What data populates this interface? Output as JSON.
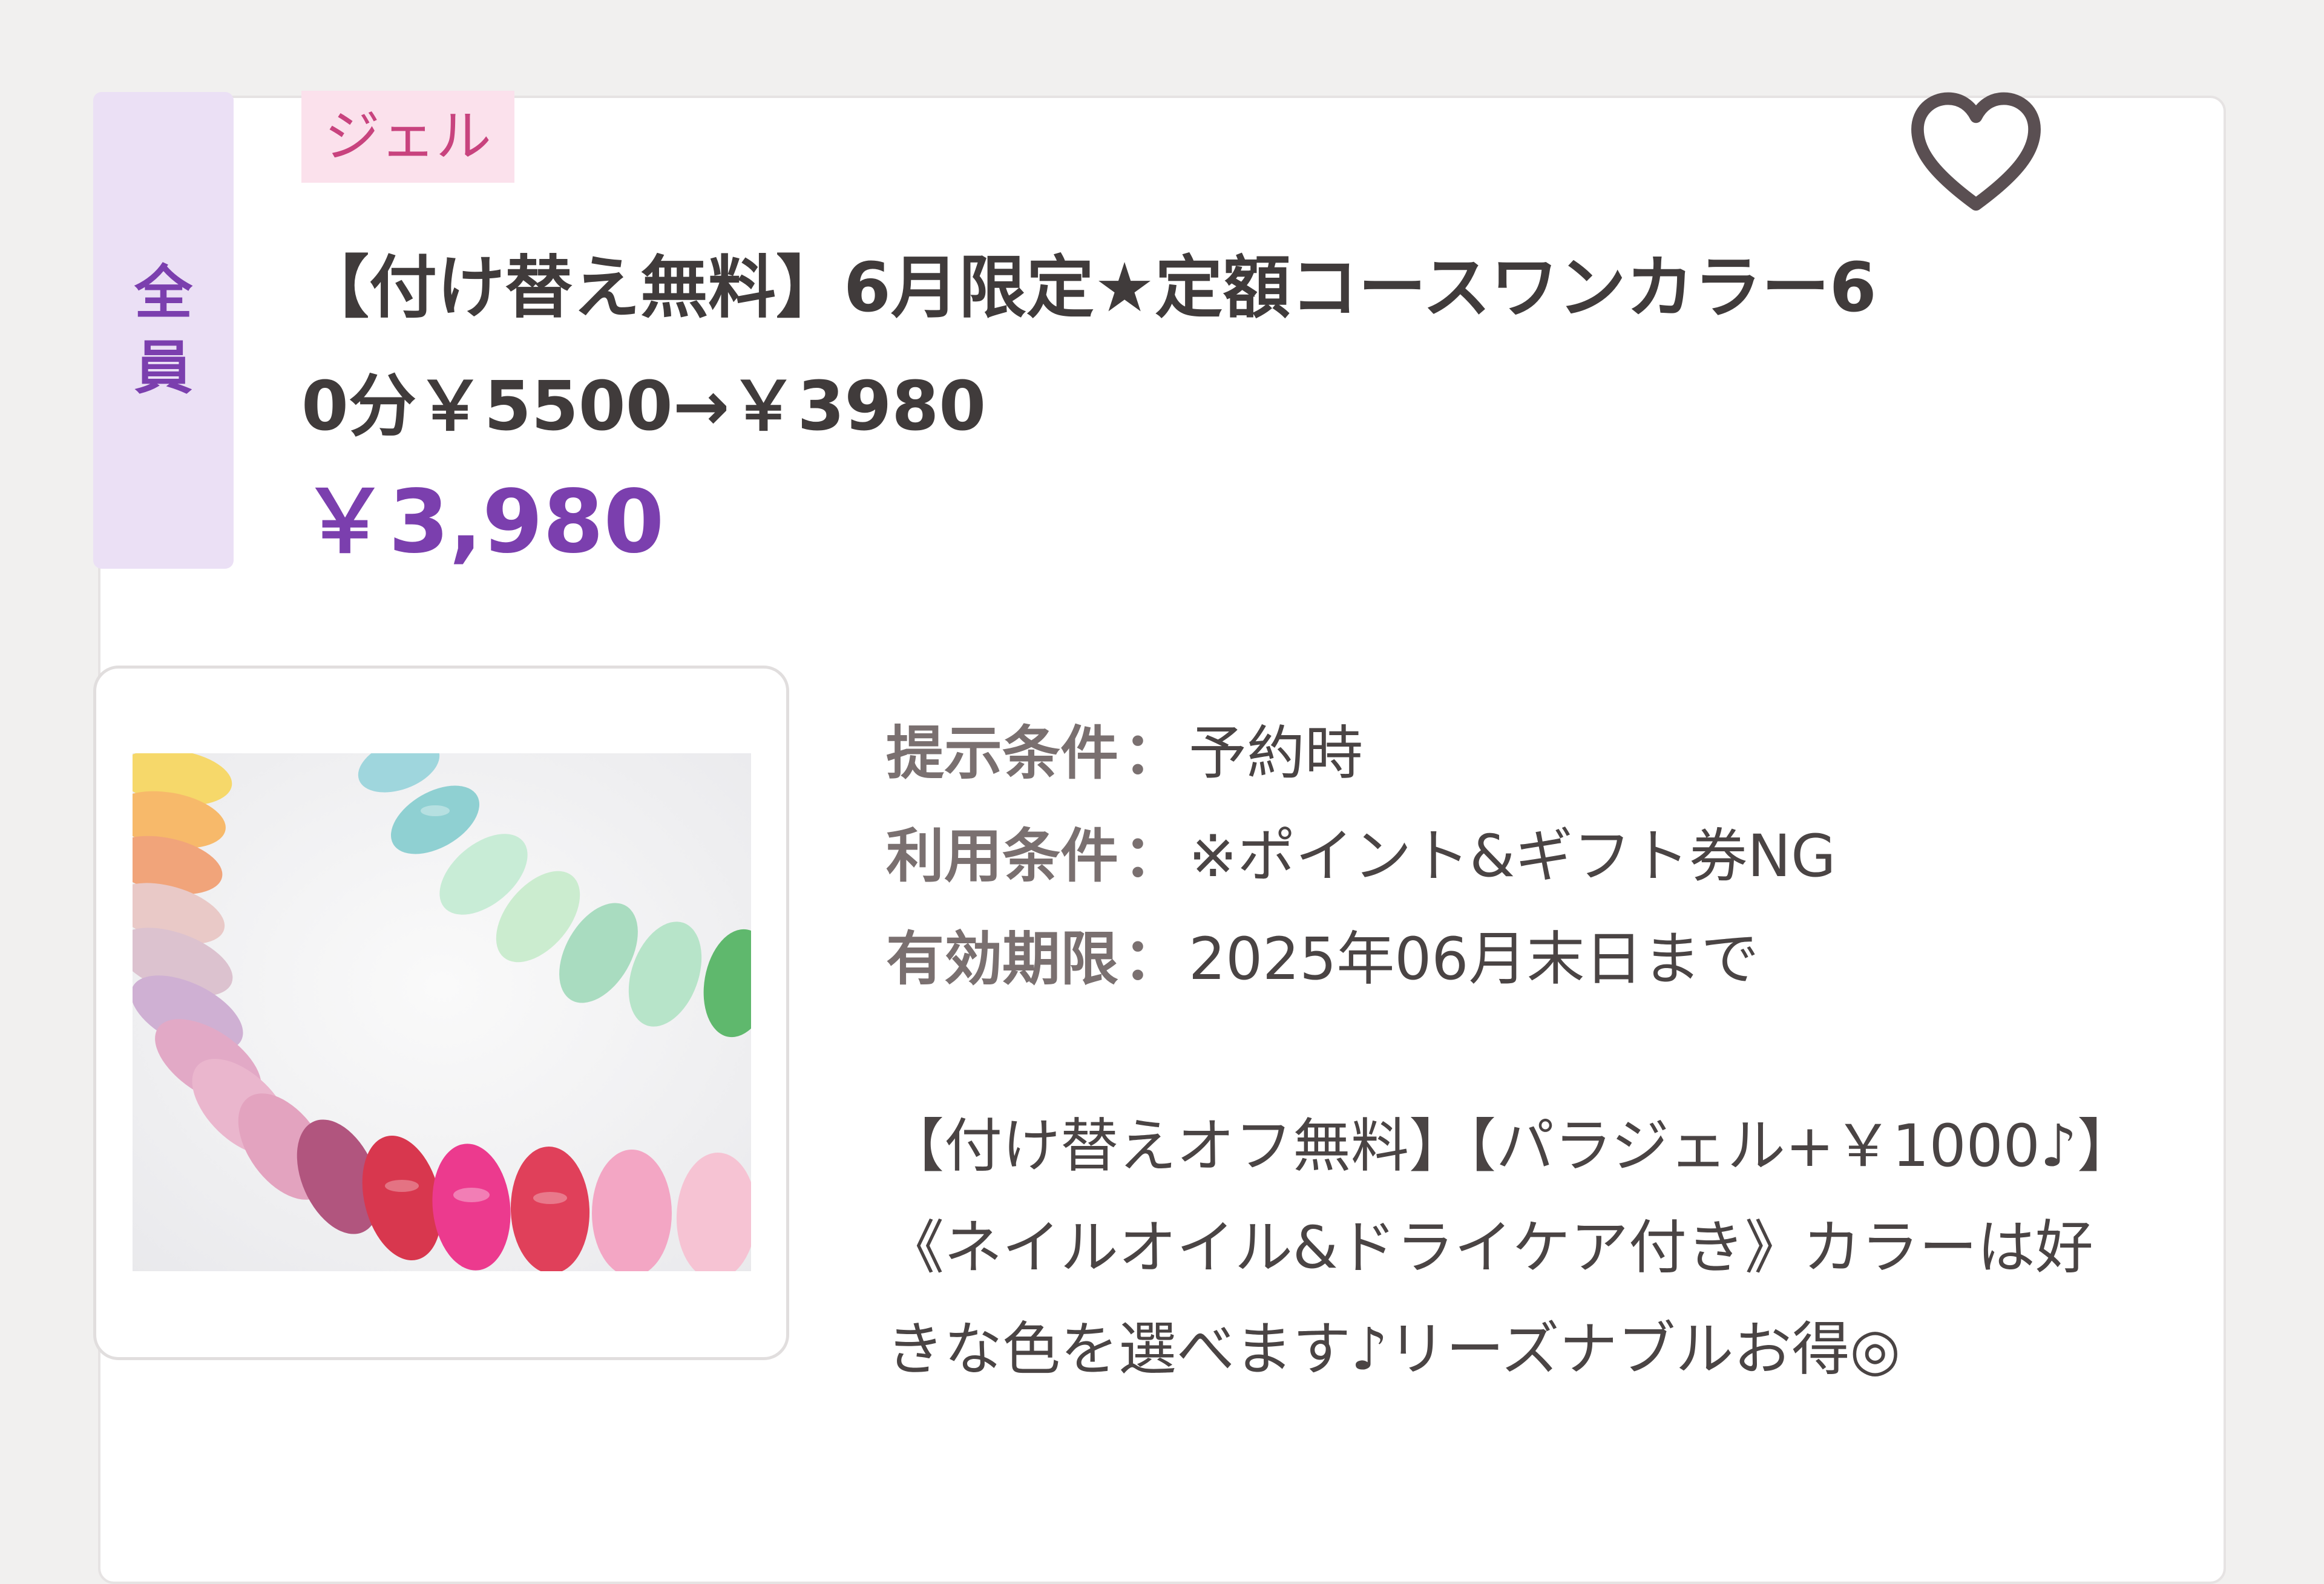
{
  "coupon": {
    "target_badge": "全員",
    "category_tag": "ジェル",
    "title": "【付け替え無料】6月限定★定額コースワンカラー60分￥5500→￥3980",
    "price": "￥3,980",
    "conditions": {
      "presentation": {
        "label": "提示条件",
        "value": "予約時"
      },
      "usage": {
        "label": "利用条件",
        "value": "※ポイント&ギフト券NG"
      },
      "expiry": {
        "label": "有効期限",
        "value": "2025年06月末日まで"
      }
    },
    "description": "【付け替えオフ無料】【パラジェル+￥1000♪】《ネイルオイル&ドライケア付き》カラーは好きな色を選べます♪リーズナブルお得◎",
    "separator": "：",
    "image_alt": "nail-color-tips-photo"
  },
  "icons": {
    "favorite": "heart-outline-icon"
  },
  "colors": {
    "accent_purple": "#7b3fae",
    "badge_bg": "#ebe0f5",
    "tag_bg": "#fbe1ec",
    "tag_text": "#c8437e",
    "heart": "#5a4f52"
  }
}
